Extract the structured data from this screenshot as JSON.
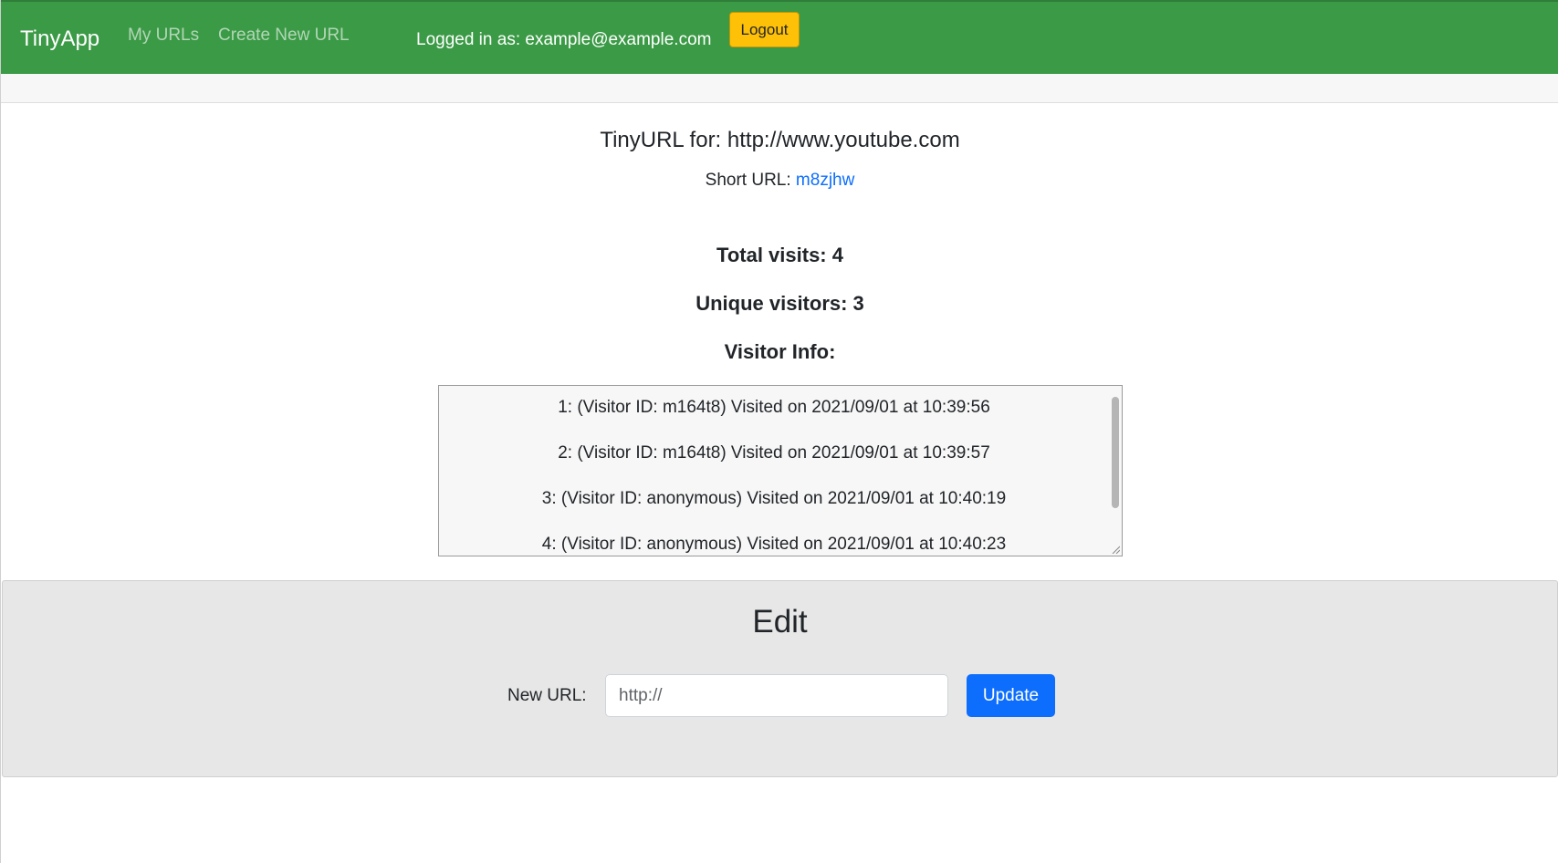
{
  "navbar": {
    "brand": "TinyApp",
    "links": [
      "My URLs",
      "Create New URL"
    ],
    "logged_in_text": "Logged in as: example@example.com",
    "logout_label": "Logout"
  },
  "url_info": {
    "title": "TinyURL for: http://www.youtube.com",
    "short_url_label": "Short URL: ",
    "short_url": "m8zjhw"
  },
  "stats": {
    "total_visits": "Total visits: 4",
    "unique_visitors": "Unique visitors: 3",
    "visitor_info_heading": "Visitor Info:"
  },
  "visitors": [
    "1: (Visitor ID: m164t8) Visited on 2021/09/01 at 10:39:56",
    "2: (Visitor ID: m164t8) Visited on 2021/09/01 at 10:39:57",
    "3: (Visitor ID: anonymous) Visited on 2021/09/01 at 10:40:19",
    "4: (Visitor ID: anonymous) Visited on 2021/09/01 at 10:40:23"
  ],
  "edit": {
    "heading": "Edit",
    "new_url_label": "New URL:",
    "new_url_placeholder": "http://",
    "update_label": "Update"
  },
  "colors": {
    "navbar": "#3b9a46",
    "logout_button": "#ffc107",
    "link": "#0d6efd",
    "update_button": "#0d6efd",
    "edit_panel": "#e7e7e7"
  }
}
